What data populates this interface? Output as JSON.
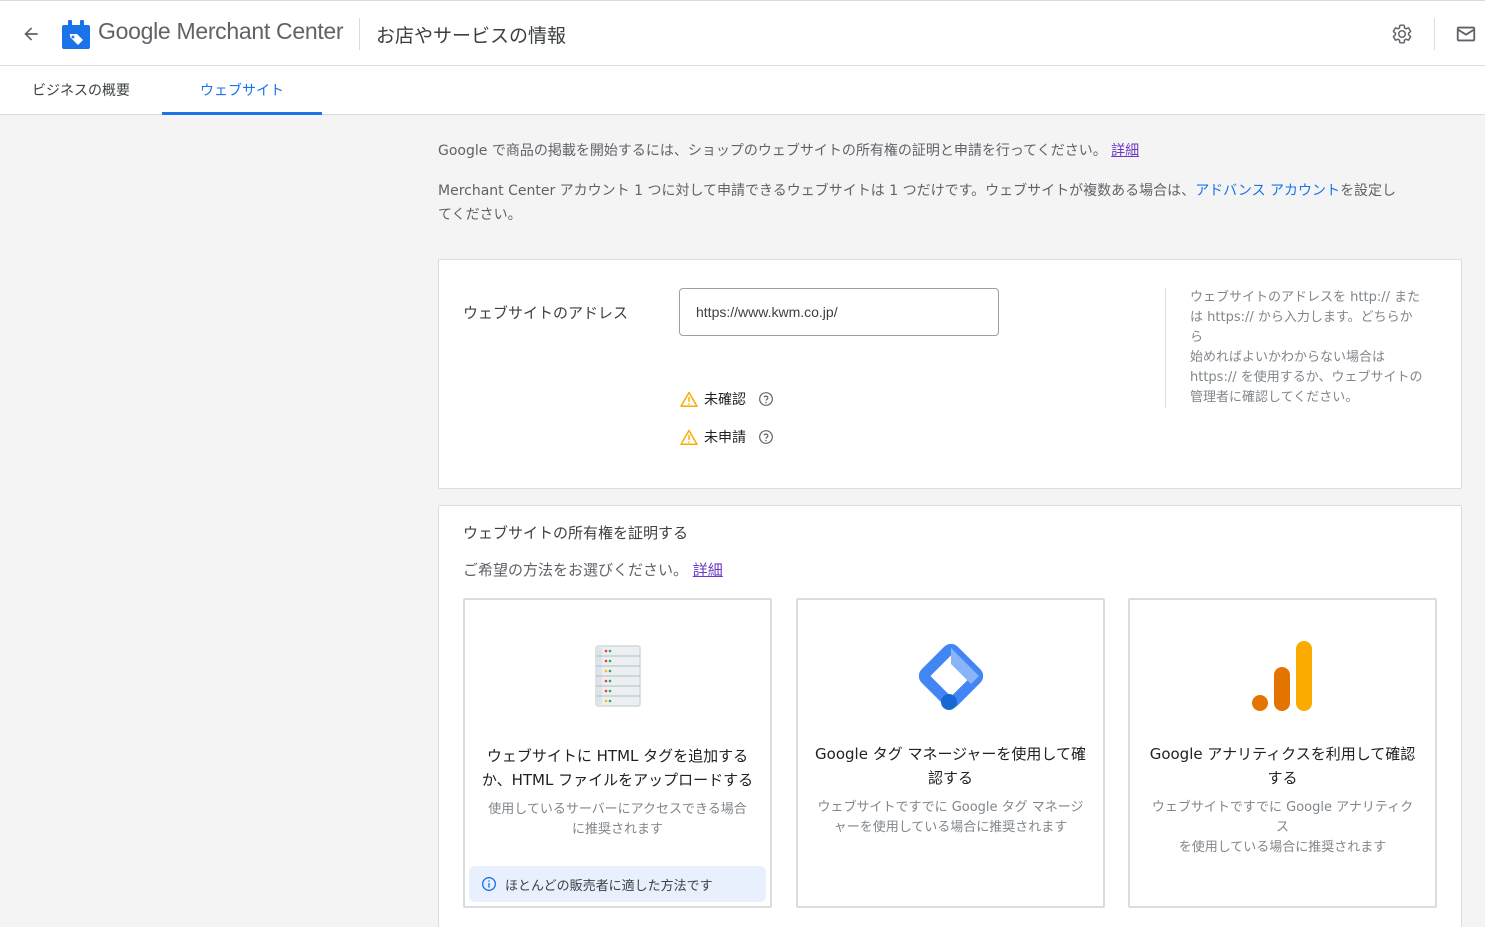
{
  "header": {
    "brand_google": "Google",
    "brand_product": "Merchant Center",
    "page_title": "お店やサービスの情報",
    "icons": [
      "arrow-back-icon",
      "merchant-center-logo",
      "gear-icon",
      "mail-icon"
    ]
  },
  "tabs": [
    {
      "label": "ビジネスの概要",
      "active": false
    },
    {
      "label": "ウェブサイト",
      "active": true
    }
  ],
  "intro": {
    "line1": "Google で商品の掲載を開始するには、ショップのウェブサイトの所有権の証明と申請を行ってください。",
    "line1_link": "詳細",
    "line2_pre": "Merchant Center アカウント 1 つに対して申請できるウェブサイトは 1 つだけです。ウェブサイトが複数ある場合は、",
    "line2_link": "アドバンス アカウント",
    "line2_post": "を設定し",
    "line3": "てください。"
  },
  "website_card": {
    "label": "ウェブサイトのアドレス",
    "url_value": "https://www.kwm.co.jp/",
    "statuses": [
      {
        "label": "未確認",
        "icon": "warning-icon"
      },
      {
        "label": "未申請",
        "icon": "warning-icon"
      }
    ],
    "help_lines": [
      "ウェブサイトのアドレスを http:// また",
      "は https:// から入力します。どちらから",
      "始めればよいかわからない場合は",
      "https:// を使用するか、ウェブサイトの",
      "管理者に確認してください。"
    ]
  },
  "verify_card": {
    "title": "ウェブサイトの所有権を証明する",
    "subtitle": "ご希望の方法をお選びください。",
    "subtitle_link": "詳細",
    "methods": [
      {
        "icon": "server-icon",
        "title_lines": [
          "ウェブサイトに HTML タグを追加する",
          "か、HTML ファイルをアップロードする"
        ],
        "desc_lines": [
          "使用しているサーバーにアクセスできる場合",
          "に推奨されます"
        ],
        "badge": "ほとんどの販売者に適した方法です"
      },
      {
        "icon": "tag-manager-icon",
        "title_lines": [
          "Google タグ マネージャーを使用して確",
          "認する"
        ],
        "desc_lines": [
          "ウェブサイトですでに Google タグ マネージ",
          "ャーを使用している場合に推奨されます"
        ]
      },
      {
        "icon": "analytics-icon",
        "title_lines": [
          "Google アナリティクスを利用して確認",
          "する"
        ],
        "desc_lines": [
          "ウェブサイトですでに Google アナリティクス",
          "を使用している場合に推奨されます"
        ]
      }
    ]
  },
  "colors": {
    "accent": "#1a73e8",
    "visited_link": "#6b39c6",
    "warning": "#f9ab00",
    "badge_bg": "#e8f0fe",
    "page_bg": "#f4f4f4"
  }
}
